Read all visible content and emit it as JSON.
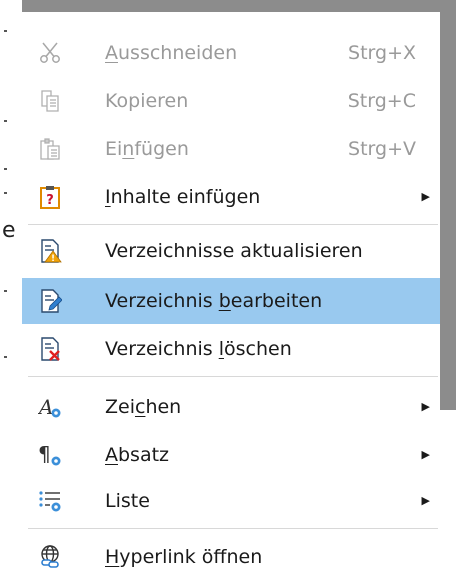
{
  "menu": {
    "items": [
      {
        "id": "cut",
        "pre": "",
        "acc": "A",
        "post": "usschneiden",
        "shortcut": "Strg+X",
        "icon": "scissors-icon",
        "disabled": true
      },
      {
        "id": "copy",
        "pre": "Kopieren",
        "acc": "",
        "post": "",
        "shortcut": "Strg+C",
        "icon": "copy-icon",
        "disabled": true
      },
      {
        "id": "paste",
        "pre": "Ei",
        "acc": "n",
        "post": "fügen",
        "shortcut": "Strg+V",
        "icon": "paste-icon",
        "disabled": true
      },
      {
        "id": "paste-special",
        "pre": "",
        "acc": "I",
        "post": "nhalte einfügen",
        "shortcut": "",
        "icon": "paste-special-icon",
        "disabled": false,
        "submenu": true
      },
      {
        "id": "update-index",
        "pre": "Verzeichnisse aktualisieren",
        "acc": "",
        "post": "",
        "shortcut": "",
        "icon": "update-index-icon",
        "disabled": false
      },
      {
        "id": "edit-index",
        "pre": "Verzeichnis ",
        "acc": "b",
        "post": "earbeiten",
        "shortcut": "",
        "icon": "edit-index-icon",
        "disabled": false,
        "highlighted": true
      },
      {
        "id": "delete-index",
        "pre": "Verzeichnis ",
        "acc": "l",
        "post": "öschen",
        "shortcut": "",
        "icon": "delete-index-icon",
        "disabled": false
      },
      {
        "id": "character",
        "pre": "Zei",
        "acc": "c",
        "post": "hen",
        "shortcut": "",
        "icon": "character-icon",
        "disabled": false,
        "submenu": true
      },
      {
        "id": "paragraph",
        "pre": "",
        "acc": "A",
        "post": "bsatz",
        "shortcut": "",
        "icon": "paragraph-icon",
        "disabled": false,
        "submenu": true
      },
      {
        "id": "list",
        "pre": "Liste",
        "acc": "",
        "post": "",
        "shortcut": "",
        "icon": "list-icon",
        "disabled": false,
        "submenu": true
      },
      {
        "id": "open-hyperlink",
        "pre": "",
        "acc": "H",
        "post": "yperlink öffnen",
        "shortcut": "",
        "icon": "hyperlink-icon",
        "disabled": false
      }
    ],
    "submenu_glyph": "▶"
  },
  "background": {
    "edge_char": "e"
  },
  "colors": {
    "highlight": "#99c9ef",
    "disabled_text": "#9a9a9a",
    "text": "#1a1a1a",
    "warning": "#f0a30a",
    "danger": "#e02020"
  }
}
